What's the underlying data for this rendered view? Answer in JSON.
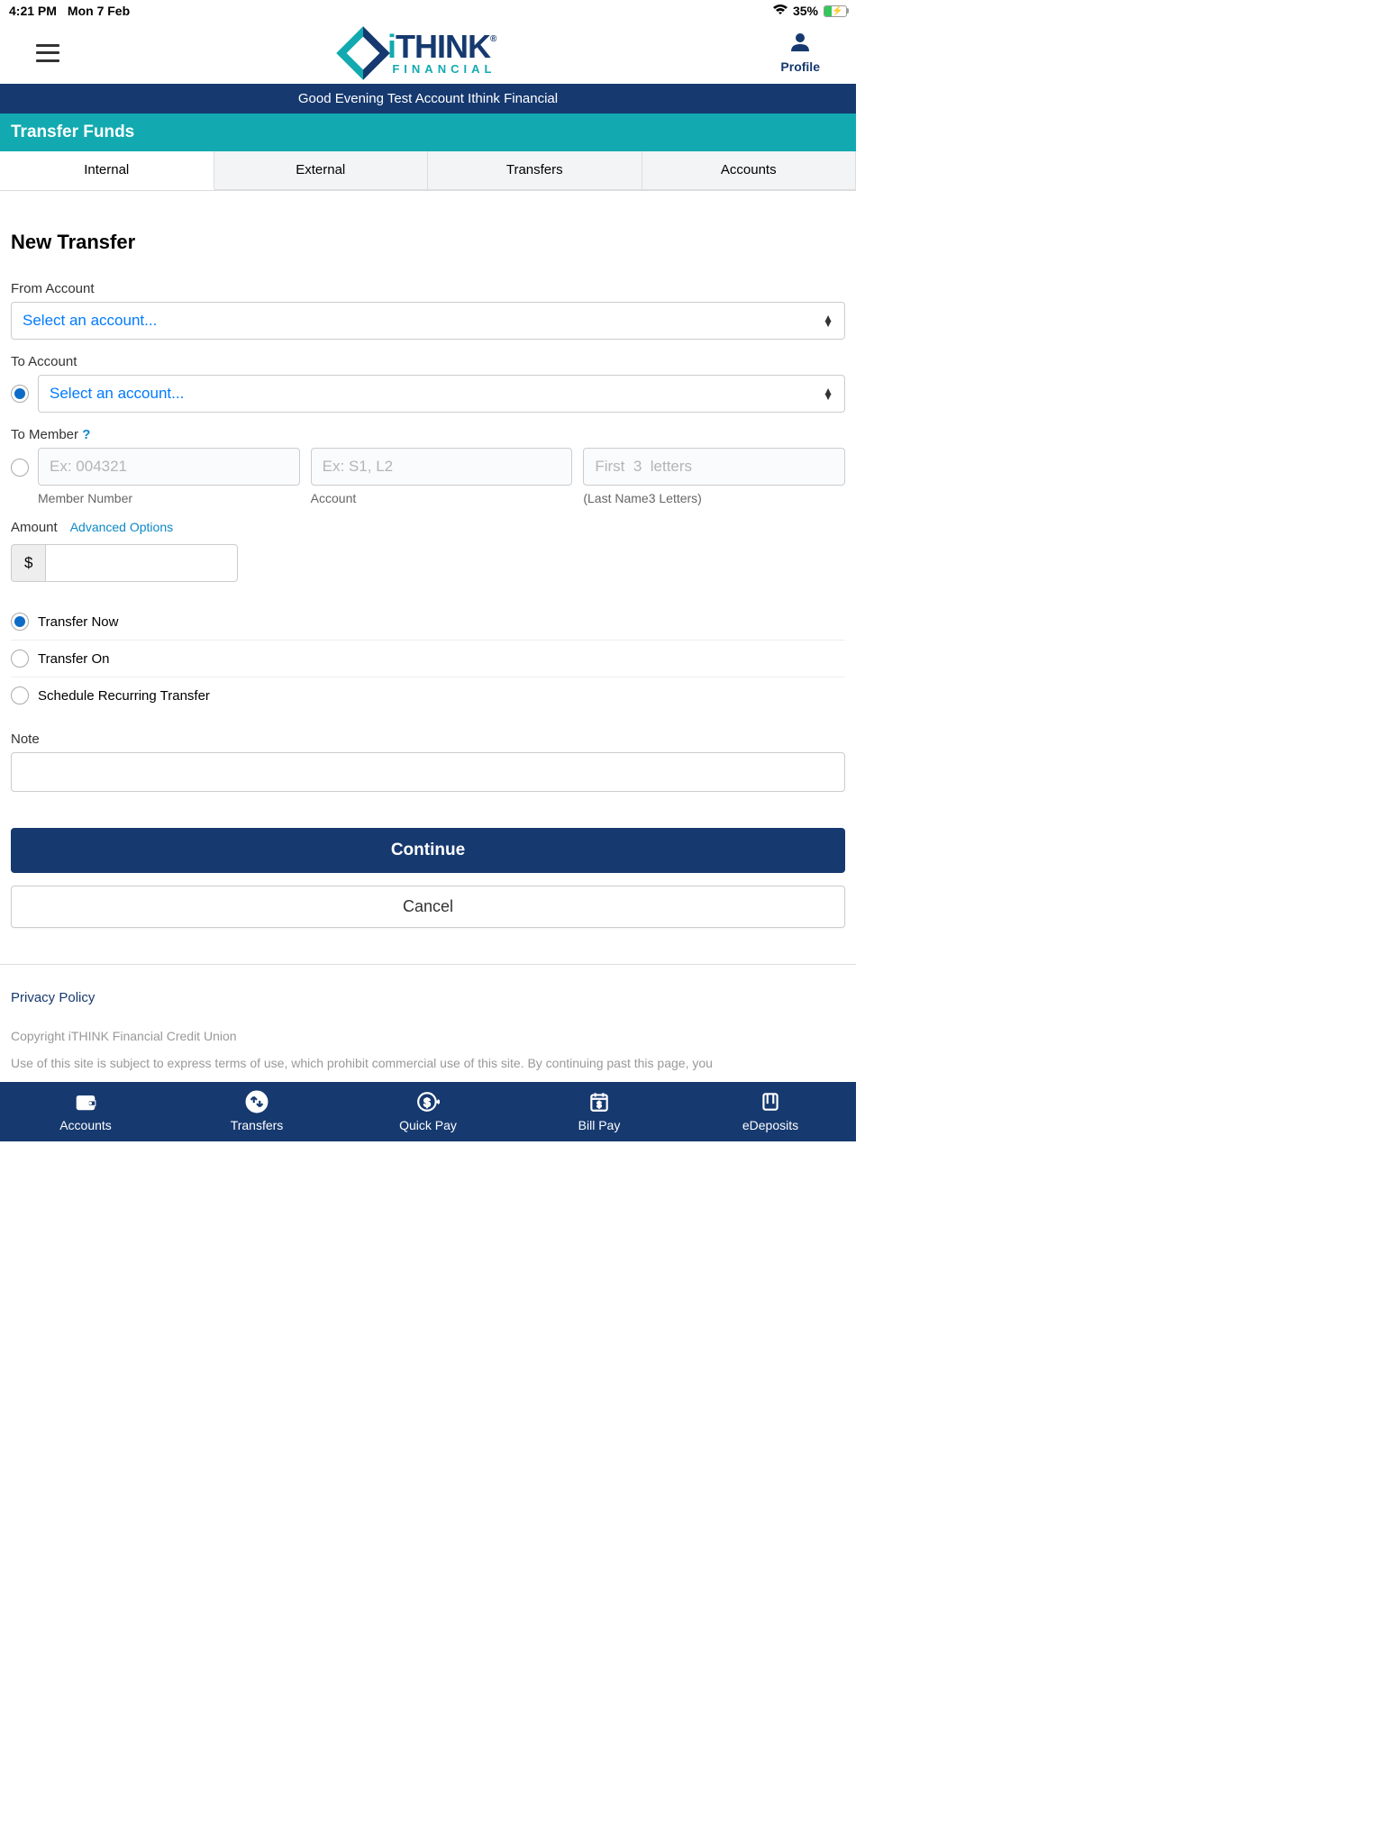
{
  "status": {
    "time": "4:21 PM",
    "date": "Mon 7 Feb",
    "battery": "35%"
  },
  "header": {
    "profile_label": "Profile",
    "logo_main": "THINK",
    "logo_sub": "FINANCIAL"
  },
  "greeting": "Good Evening Test Account Ithink Financial",
  "page_title": "Transfer Funds",
  "tabs": [
    "Internal",
    "External",
    "Transfers",
    "Accounts"
  ],
  "section_title": "New Transfer",
  "form": {
    "from_label": "From Account",
    "from_placeholder": "Select an account...",
    "to_label": "To Account",
    "to_placeholder": "Select an account...",
    "member_label": "To Member",
    "member_num_ph": "Ex: 004321",
    "member_num_sub": "Member Number",
    "member_acct_ph": "Ex: S1, L2",
    "member_acct_sub": "Account",
    "member_last_ph": "First  3  letters",
    "member_last_sub": "(Last Name3  Letters)",
    "amount_label": "Amount",
    "adv_options": "Advanced Options",
    "currency": "$",
    "schedule_opts": [
      "Transfer Now",
      "Transfer On",
      "Schedule Recurring Transfer"
    ],
    "note_label": "Note",
    "continue": "Continue",
    "cancel": "Cancel"
  },
  "footer": {
    "privacy": "Privacy Policy",
    "copyright": "Copyright iTHINK Financial Credit Union",
    "terms": "Use of this site is subject to express terms of use, which prohibit commercial use of this site. By continuing past this page, you"
  },
  "nav": [
    "Accounts",
    "Transfers",
    "Quick Pay",
    "Bill Pay",
    "eDeposits"
  ]
}
